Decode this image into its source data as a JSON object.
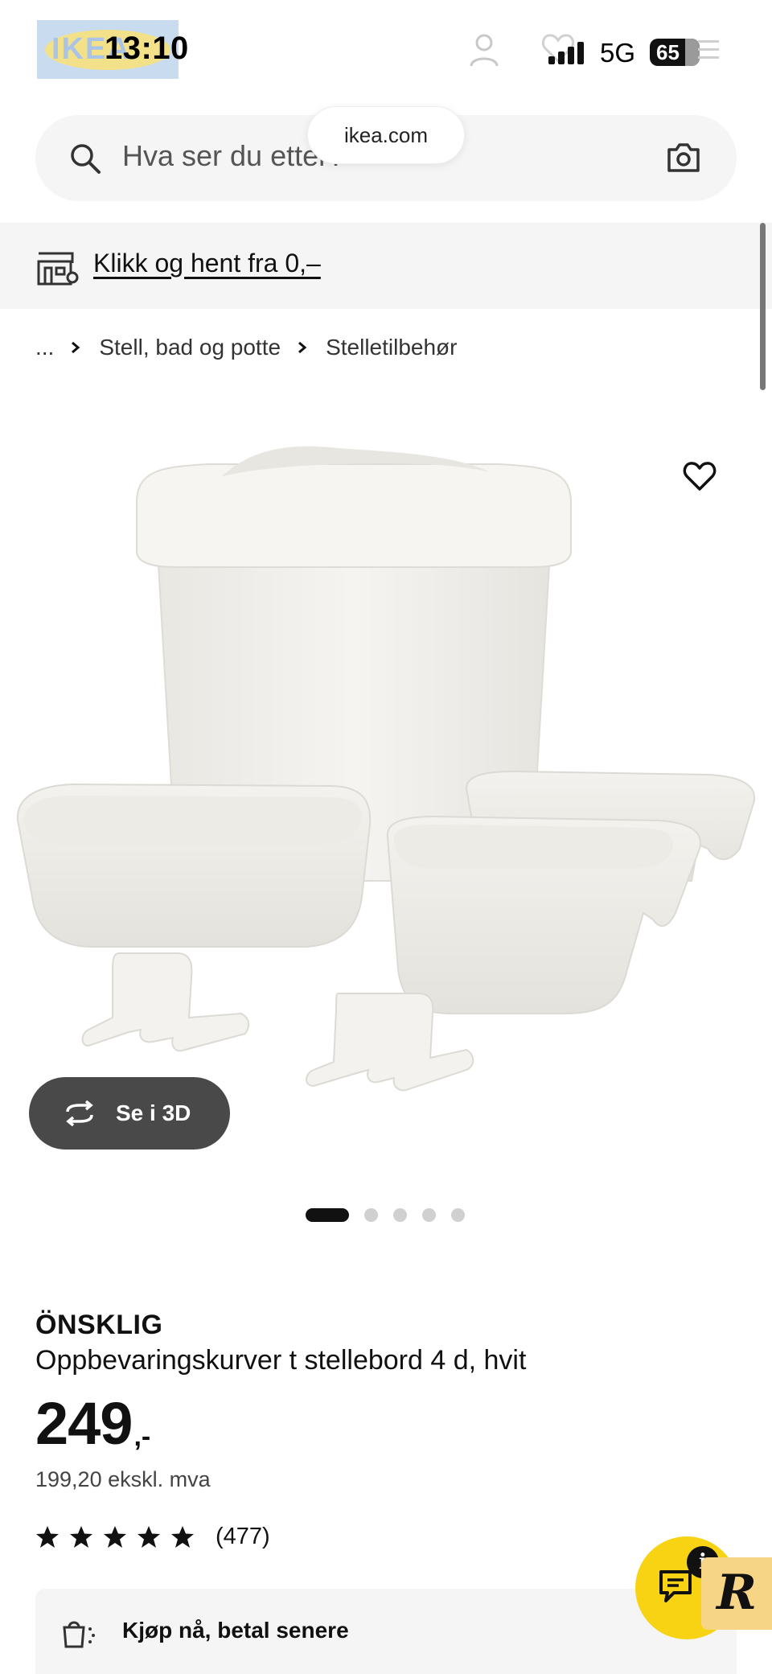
{
  "status_bar": {
    "time": "13:10",
    "network": "5G",
    "battery": "65",
    "logo_text": "IKEA"
  },
  "browser": {
    "url": "ikea.com"
  },
  "search": {
    "placeholder": "Hva ser du etter?"
  },
  "pickup_banner": {
    "label": "Klikk og hent fra 0,–"
  },
  "breadcrumb": {
    "items": [
      "...",
      "Stell, bad og potte",
      "Stelletilbehør"
    ]
  },
  "gallery": {
    "view_3d_label": "Se i 3D",
    "slide_count": 5,
    "active_slide": 1
  },
  "product": {
    "brand": "ÖNSKLIG",
    "description": "Oppbevaringskurver t stellebord 4 d, hvit",
    "price": "249",
    "price_suffix": ",-",
    "price_ex_vat": "199,20 ekskl. mva",
    "rating_stars": 5,
    "review_count": "(477)"
  },
  "pay_later": {
    "label": "Kjøp nå, betal senere"
  },
  "chat_widget": {
    "info_label": "i",
    "badge_letter": "R"
  },
  "colors": {
    "chat_yellow": "#f7d314",
    "button_dark": "#494949",
    "panel_gray": "#f5f5f5"
  }
}
